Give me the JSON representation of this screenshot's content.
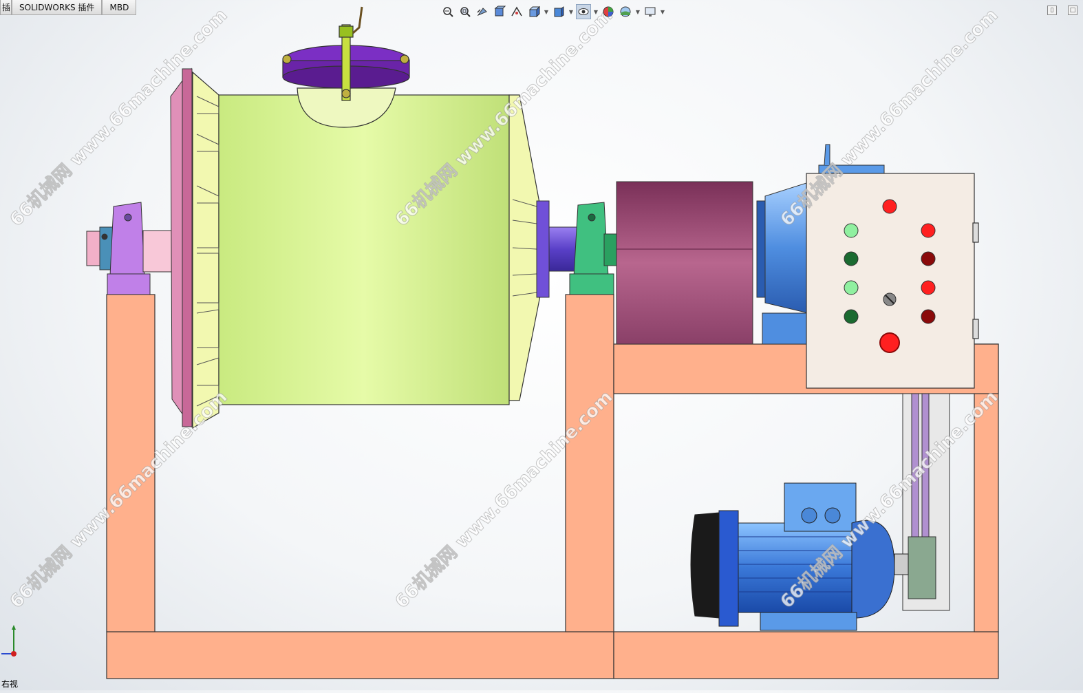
{
  "tabs": [
    {
      "label": "插"
    },
    {
      "label": "SOLIDWORKS 插件"
    },
    {
      "label": "MBD"
    }
  ],
  "hud_tools": [
    {
      "icon": "zoom-to-fit-icon"
    },
    {
      "icon": "zoom-to-area-icon"
    },
    {
      "icon": "previous-view-icon"
    },
    {
      "icon": "section-view-icon"
    },
    {
      "icon": "dynamic-annotation-icon"
    },
    {
      "icon": "view-orientation-icon",
      "dropdown": true
    },
    {
      "icon": "display-style-icon",
      "dropdown": true
    },
    {
      "icon": "hide-show-items-icon",
      "dropdown": true,
      "active": true
    },
    {
      "icon": "edit-appearance-icon"
    },
    {
      "icon": "apply-scene-icon",
      "dropdown": true
    },
    {
      "icon": "view-settings-icon",
      "dropdown": true
    }
  ],
  "view_label": "右视",
  "watermark": {
    "text": "66机械网  www.66machine.com"
  },
  "colors": {
    "frame": "#ffb08c",
    "drum": "#e1f7a0",
    "lid": "#7b2fc4",
    "flange": "#e090b8",
    "shaft": "#7050d8",
    "bearing_left": "#c080e8",
    "bearing_right": "#40c080",
    "reducer_housing": "#a0507a",
    "gearbox": "#4f8ee0",
    "control_box": "#f4ece4",
    "motor": "#4a90e8",
    "lamp_green": "#90f0a0",
    "lamp_green_dark": "#1a6a30",
    "lamp_red": "#ff2020",
    "lamp_red_dark": "#8a0a0a",
    "belt": "#b090d0"
  }
}
